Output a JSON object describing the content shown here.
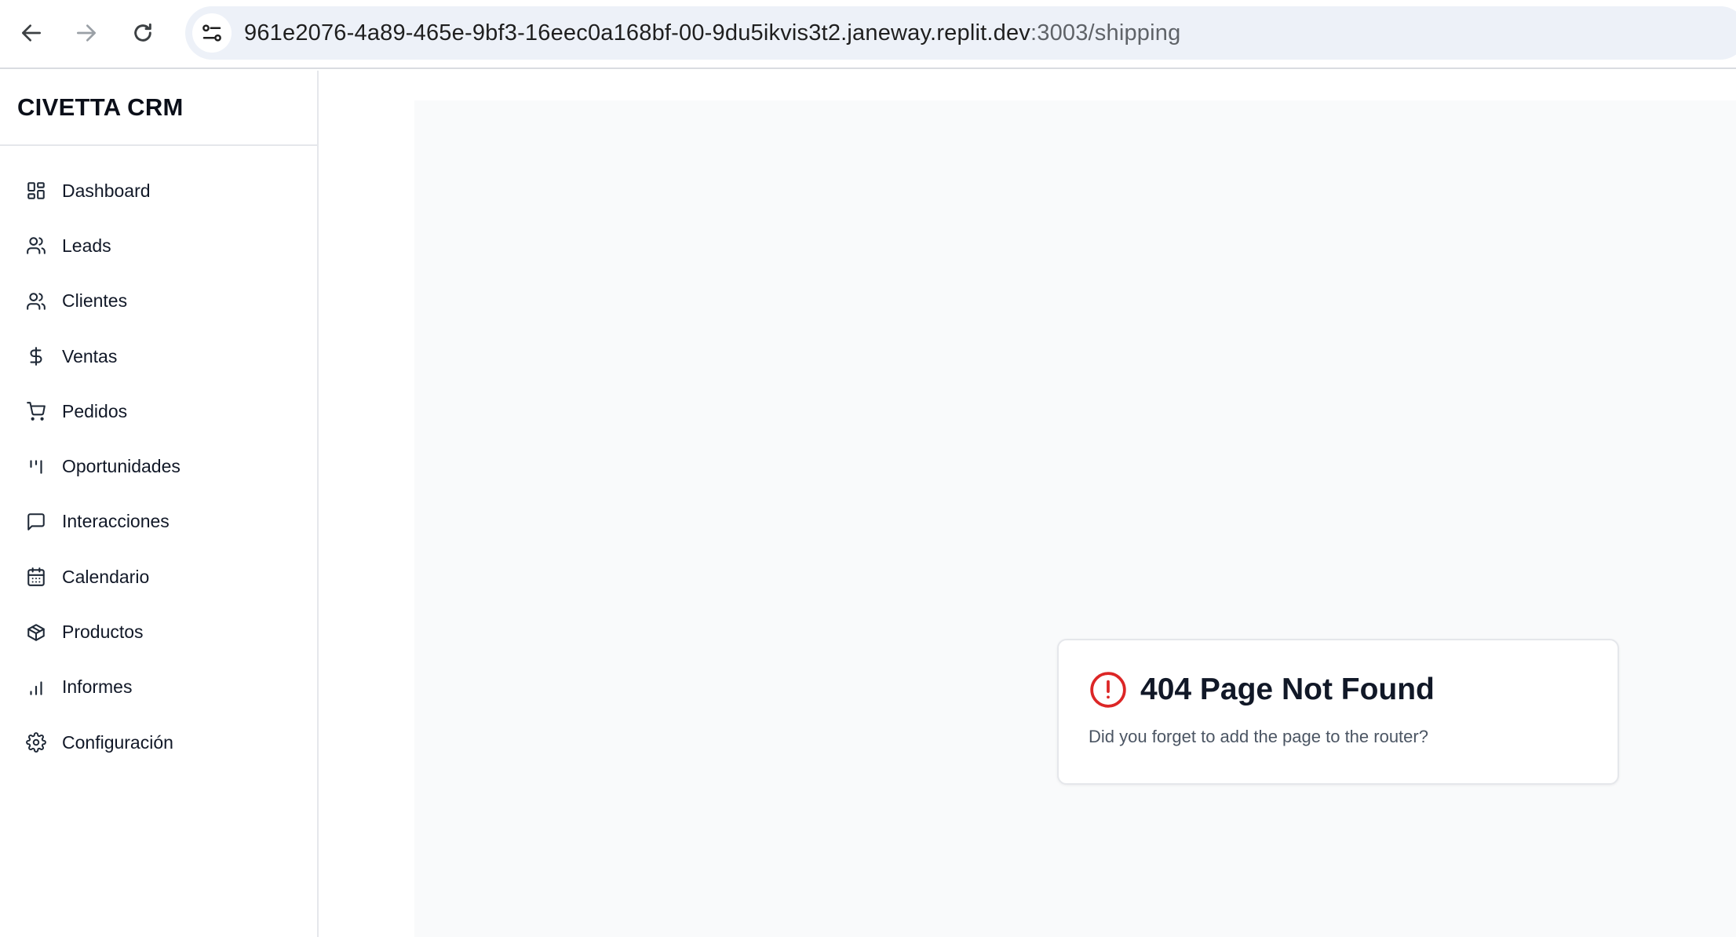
{
  "browser": {
    "url_host": "961e2076-4a89-465e-9bf3-16eec0a168bf-00-9du5ikvis3t2.janeway.replit.dev",
    "url_path": ":3003/shipping",
    "icons": [
      "back-arrow-icon",
      "forward-arrow-icon",
      "reload-icon",
      "site-settings-icon"
    ]
  },
  "sidebar": {
    "brand": "CIVETTA CRM",
    "items": [
      {
        "label": "Dashboard",
        "icon": "dashboard-icon"
      },
      {
        "label": "Leads",
        "icon": "users-icon"
      },
      {
        "label": "Clientes",
        "icon": "users-icon"
      },
      {
        "label": "Ventas",
        "icon": "dollar-icon"
      },
      {
        "label": "Pedidos",
        "icon": "cart-icon"
      },
      {
        "label": "Oportunidades",
        "icon": "kanban-icon"
      },
      {
        "label": "Interacciones",
        "icon": "message-icon"
      },
      {
        "label": "Calendario",
        "icon": "calendar-icon"
      },
      {
        "label": "Productos",
        "icon": "package-icon"
      },
      {
        "label": "Informes",
        "icon": "bar-chart-icon"
      },
      {
        "label": "Configuración",
        "icon": "settings-icon"
      }
    ]
  },
  "not_found": {
    "title": "404 Page Not Found",
    "message": "Did you forget to add the page to the router?",
    "icon": "alert-circle-icon",
    "icon_color": "#dc2626"
  }
}
